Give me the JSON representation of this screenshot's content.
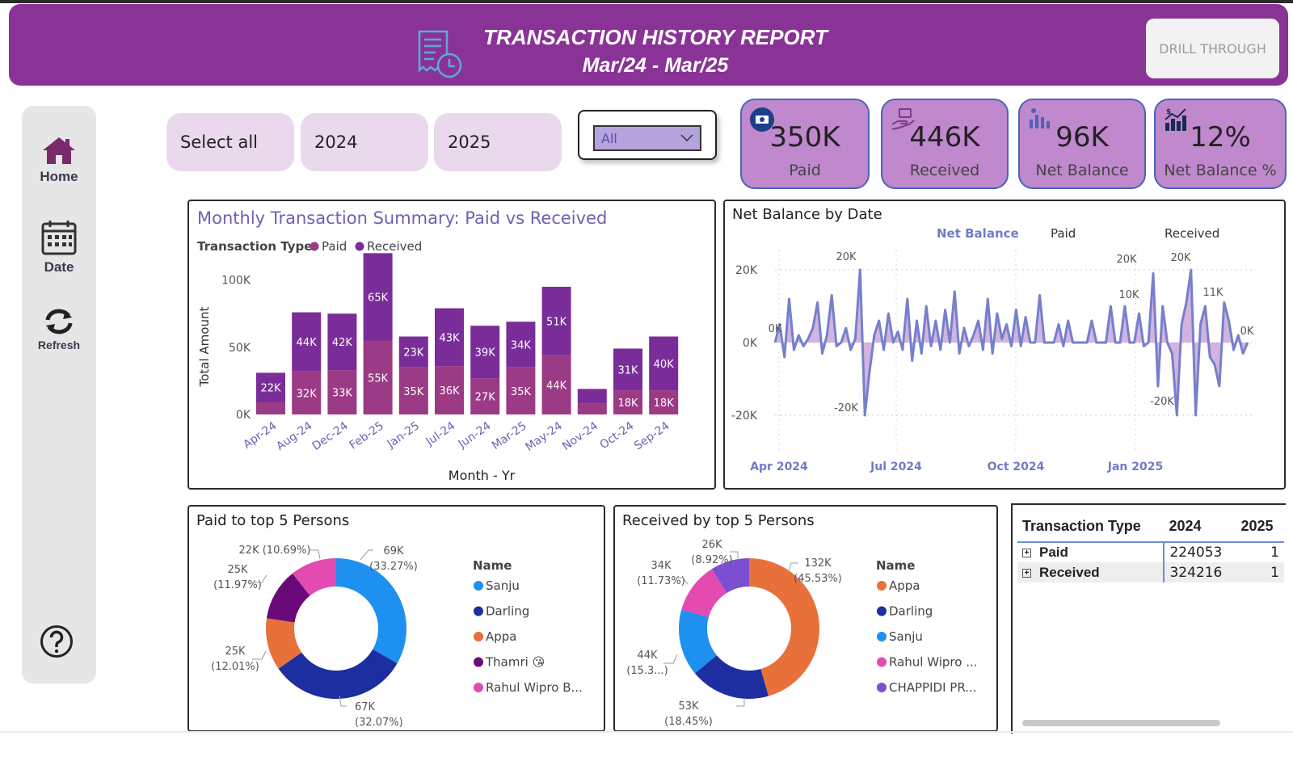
{
  "header": {
    "title": "TRANSACTION HISTORY REPORT",
    "subtitle": "Mar/24 - Mar/25",
    "drill_label": "DRILL THROUGH"
  },
  "nav": {
    "home": "Home",
    "date": "Date",
    "refresh": "Refresh"
  },
  "slicers": {
    "select_all": "Select all",
    "y2024": "2024",
    "y2025": "2025",
    "dropdown_value": "All"
  },
  "kpis": [
    {
      "value": "350K",
      "label": "Paid",
      "icon": "money-badge-icon"
    },
    {
      "value": "446K",
      "label": "Received",
      "icon": "hand-money-icon"
    },
    {
      "value": "96K",
      "label": "Net Balance",
      "icon": "bar-chart-icon"
    },
    {
      "value": "12%",
      "label": "Net Balance %",
      "icon": "growth-chart-icon"
    }
  ],
  "colors": {
    "header": "#8a3396",
    "paid": "#9b3a85",
    "received": "#7a2d98",
    "line": "#7580cc",
    "kpi_bg": "#c088cd",
    "donut": [
      "#1e90f0",
      "#1c2ea0",
      "#e8703a",
      "#6a0a7a",
      "#e34bb0",
      "#7a4fd0"
    ]
  },
  "chart_data": [
    {
      "type": "bar",
      "title": "Monthly Transaction Summary: Paid vs Received",
      "legend_title": "Transaction Type",
      "legend_position": "top-left",
      "xlabel": "Month - Yr",
      "ylabel": "Total Amount",
      "categories": [
        "Apr-24",
        "Aug-24",
        "Dec-24",
        "Feb-25",
        "Jan-25",
        "Jul-24",
        "Jun-24",
        "Mar-25",
        "May-24",
        "Nov-24",
        "Oct-24",
        "Sep-24"
      ],
      "ylim": [
        0,
        110000
      ],
      "yticks": [
        "0K",
        "50K",
        "100K"
      ],
      "series": [
        {
          "name": "Paid",
          "values": [
            9000,
            32000,
            33000,
            55000,
            35000,
            36000,
            27000,
            35000,
            44000,
            8000,
            18000,
            18000
          ],
          "labels": [
            "",
            "32K",
            "33K",
            "55K",
            "35K",
            "36K",
            "27K",
            "35K",
            "44K",
            "",
            "18K",
            "18K"
          ]
        },
        {
          "name": "Received",
          "values": [
            22000,
            44000,
            42000,
            65000,
            23000,
            43000,
            39000,
            34000,
            51000,
            11000,
            31000,
            40000
          ],
          "labels": [
            "22K",
            "44K",
            "42K",
            "65K",
            "23K",
            "43K",
            "39K",
            "34K",
            "51K",
            "",
            "31K",
            "40K"
          ]
        }
      ]
    },
    {
      "type": "line",
      "title": "Net Balance by Date",
      "legend": [
        "Net Balance",
        "Paid",
        "Received"
      ],
      "legend_position": "top",
      "grid": true,
      "ylim": [
        -20000,
        20000
      ],
      "yticks": [
        "-20K",
        "0K",
        "20K"
      ],
      "xticks": [
        "Apr 2024",
        "Jul 2024",
        "Oct 2024",
        "Jan 2025"
      ],
      "annotations": [
        "0K",
        "20K",
        "-20K",
        "20K",
        "10K",
        "20K",
        "-20K",
        "11K",
        "0K"
      ],
      "series": [
        {
          "name": "Net Balance",
          "values": [
            0,
            5,
            -4,
            12,
            -2,
            2,
            -1,
            1,
            4,
            11,
            -3,
            2,
            13,
            -1,
            0,
            4,
            -2,
            1,
            20,
            -20,
            -8,
            2,
            6,
            -2,
            8,
            0,
            3,
            -2,
            12,
            -5,
            6,
            -3,
            10,
            -1,
            6,
            -2,
            9,
            0,
            14,
            -3,
            4,
            -1,
            2,
            6,
            -2,
            12,
            -3,
            8,
            1,
            5,
            -1,
            9,
            -1,
            7,
            0,
            0,
            13,
            0,
            0,
            0,
            5,
            -1,
            6,
            0,
            0,
            0,
            0,
            6,
            0,
            0,
            0,
            10,
            0,
            0,
            10,
            0,
            0,
            8,
            -1,
            0,
            19,
            -12,
            10,
            0,
            -3,
            -20,
            5,
            11,
            20,
            -20,
            5,
            10,
            -4,
            -6,
            -12,
            11,
            6,
            -2,
            2,
            -3,
            0
          ]
        }
      ]
    },
    {
      "type": "pie",
      "title": "Paid to top 5 Persons",
      "legend_title": "Name",
      "legend_position": "right",
      "labels": [
        "Sanju",
        "Darling",
        "Appa",
        "Thamri 😘",
        "Rahul Wipro B..."
      ],
      "values": [
        33.27,
        32.07,
        12.01,
        11.97,
        10.69
      ],
      "data_labels": [
        "69K (33.27%)",
        "67K (32.07%)",
        "25K (12.01%)",
        "25K (11.97%)",
        "22K (10.69%)"
      ]
    },
    {
      "type": "pie",
      "title": "Received by top 5 Persons",
      "legend_title": "Name",
      "legend_position": "right",
      "labels": [
        "Appa",
        "Darling",
        "Sanju",
        "Rahul Wipro ...",
        "CHAPPIDI PR..."
      ],
      "values": [
        45.53,
        18.45,
        15.3,
        11.73,
        8.92
      ],
      "data_labels": [
        "132K (45.53%)",
        "53K (18.45%)",
        "44K (15.3...)",
        "34K (11.73%)",
        "26K (8.92%)"
      ]
    }
  ],
  "table": {
    "headers": [
      "Transaction Type",
      "2024",
      "2025"
    ],
    "rows": [
      {
        "type": "Paid",
        "y2024": "224053",
        "y2025": "1"
      },
      {
        "type": "Received",
        "y2024": "324216",
        "y2025": "1"
      }
    ]
  }
}
